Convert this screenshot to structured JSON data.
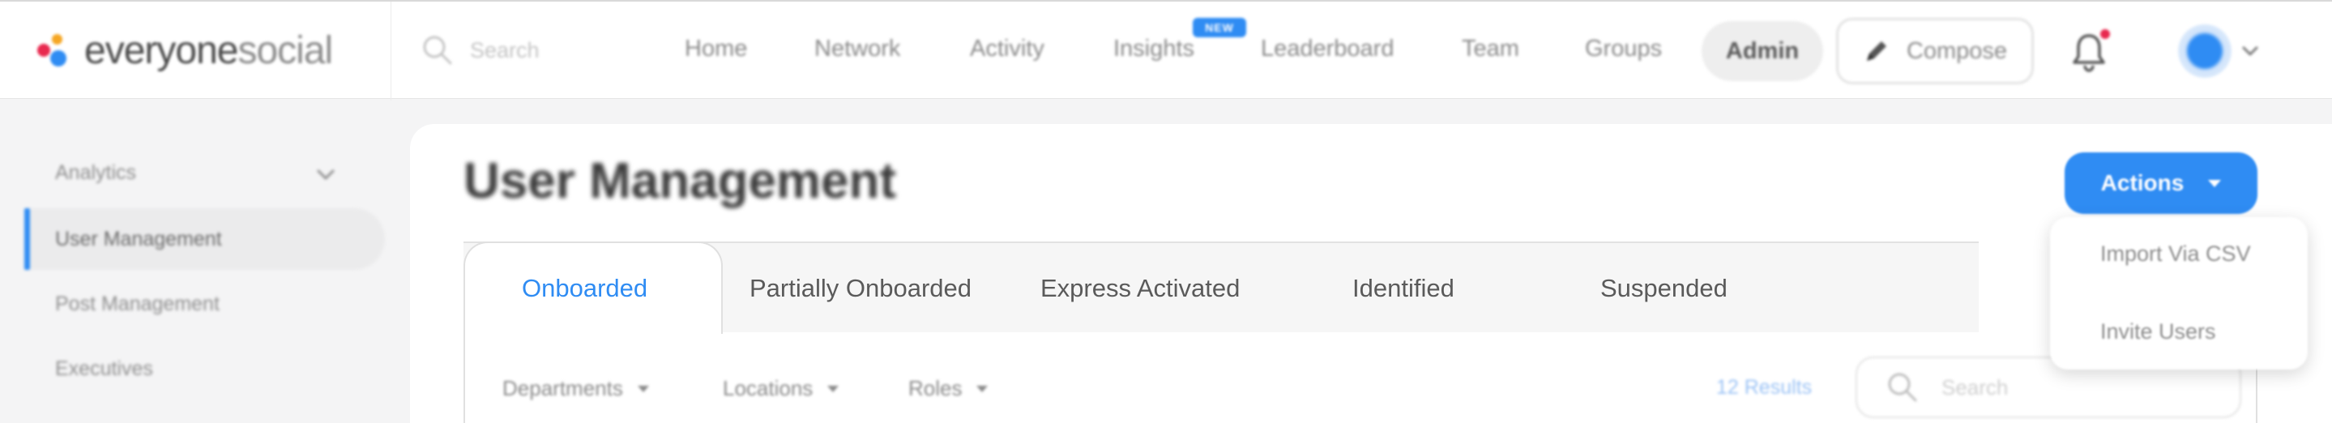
{
  "brand": {
    "logo_text_part1": "everyone",
    "logo_text_part2": "social",
    "colors": {
      "accent": "#2f8cf3",
      "notification": "#e8294f",
      "logo_red": "#e8294f",
      "logo_orange": "#f5a623",
      "logo_blue": "#2f8cf3"
    }
  },
  "topnav": {
    "search_placeholder": "Search",
    "items": [
      "Home",
      "Network",
      "Activity",
      "Insights",
      "Leaderboard",
      "Team",
      "Groups"
    ],
    "insights_badge": "NEW",
    "admin_label": "Admin",
    "compose_label": "Compose",
    "icons": {
      "search": "search-icon",
      "compose": "pencil-icon",
      "bell": "bell-icon",
      "avatar": "avatar",
      "chevron": "chevron-down-icon"
    }
  },
  "sidebar": {
    "items": [
      {
        "label": "Analytics",
        "expandable": true
      },
      {
        "label": "User Management",
        "active": true
      },
      {
        "label": "Post Management"
      },
      {
        "label": "Executives"
      }
    ]
  },
  "page": {
    "title": "User Management",
    "actions_label": "Actions",
    "actions_menu": [
      "Import Via CSV",
      "Invite Users"
    ],
    "tabs": [
      "Onboarded",
      "Partially Onboarded",
      "Express Activated",
      "Identified",
      "Suspended"
    ],
    "active_tab": "Onboarded",
    "filters": [
      "Departments",
      "Locations",
      "Roles"
    ],
    "results_text": "12 Results",
    "table_search_placeholder": "Search"
  }
}
